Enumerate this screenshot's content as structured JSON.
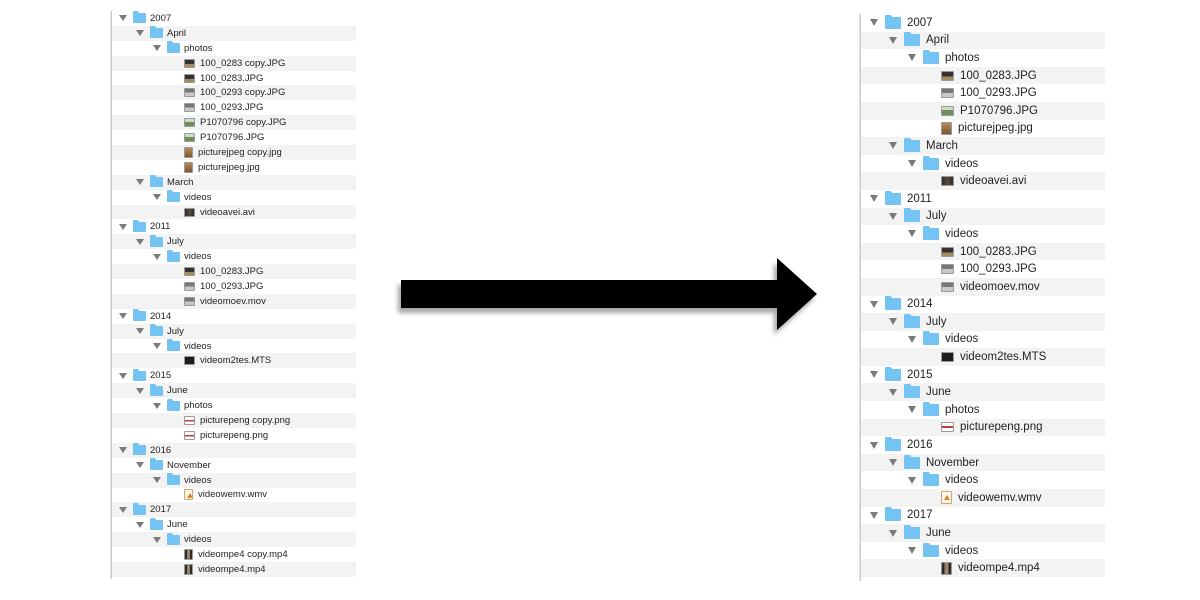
{
  "left_tree": [
    {
      "label": "2007",
      "level": 0,
      "kind": "folder"
    },
    {
      "label": "April",
      "level": 1,
      "kind": "folder"
    },
    {
      "label": "photos",
      "level": 2,
      "kind": "folder"
    },
    {
      "label": "100_0283 copy.JPG",
      "level": 3,
      "kind": "file",
      "icon": "dark"
    },
    {
      "label": "100_0283.JPG",
      "level": 3,
      "kind": "file",
      "icon": "dark"
    },
    {
      "label": "100_0293 copy.JPG",
      "level": 3,
      "kind": "file",
      "icon": "gray"
    },
    {
      "label": "100_0293.JPG",
      "level": 3,
      "kind": "file",
      "icon": "gray"
    },
    {
      "label": "P1070796 copy.JPG",
      "level": 3,
      "kind": "file",
      "icon": "green"
    },
    {
      "label": "P1070796.JPG",
      "level": 3,
      "kind": "file",
      "icon": "green"
    },
    {
      "label": "picturejpeg copy.jpg",
      "level": 3,
      "kind": "file",
      "icon": "doc"
    },
    {
      "label": "picturejpeg.jpg",
      "level": 3,
      "kind": "file",
      "icon": "doc"
    },
    {
      "label": "March",
      "level": 1,
      "kind": "folder"
    },
    {
      "label": "videos",
      "level": 2,
      "kind": "folder"
    },
    {
      "label": "videoavei.avi",
      "level": 3,
      "kind": "file",
      "icon": "video"
    },
    {
      "label": "2011",
      "level": 0,
      "kind": "folder"
    },
    {
      "label": "July",
      "level": 1,
      "kind": "folder"
    },
    {
      "label": "videos",
      "level": 2,
      "kind": "folder"
    },
    {
      "label": "100_0283.JPG",
      "level": 3,
      "kind": "file",
      "icon": "dark"
    },
    {
      "label": "100_0293.JPG",
      "level": 3,
      "kind": "file",
      "icon": "gray"
    },
    {
      "label": "videomoev.mov",
      "level": 3,
      "kind": "file",
      "icon": "gray"
    },
    {
      "label": "2014",
      "level": 0,
      "kind": "folder"
    },
    {
      "label": "July",
      "level": 1,
      "kind": "folder"
    },
    {
      "label": "videos",
      "level": 2,
      "kind": "folder"
    },
    {
      "label": "videom2tes.MTS",
      "level": 3,
      "kind": "file",
      "icon": "film"
    },
    {
      "label": "2015",
      "level": 0,
      "kind": "folder"
    },
    {
      "label": "June",
      "level": 1,
      "kind": "folder"
    },
    {
      "label": "photos",
      "level": 2,
      "kind": "folder"
    },
    {
      "label": "picturepeng copy.png",
      "level": 3,
      "kind": "file",
      "icon": "png"
    },
    {
      "label": "picturepeng.png",
      "level": 3,
      "kind": "file",
      "icon": "png"
    },
    {
      "label": "2016",
      "level": 0,
      "kind": "folder"
    },
    {
      "label": "November",
      "level": 1,
      "kind": "folder"
    },
    {
      "label": "videos",
      "level": 2,
      "kind": "folder"
    },
    {
      "label": "videowemv.wmv",
      "level": 3,
      "kind": "file",
      "icon": "wmv"
    },
    {
      "label": "2017",
      "level": 0,
      "kind": "folder"
    },
    {
      "label": "June",
      "level": 1,
      "kind": "folder"
    },
    {
      "label": "videos",
      "level": 2,
      "kind": "folder"
    },
    {
      "label": "videompe4 copy.mp4",
      "level": 3,
      "kind": "file",
      "icon": "mp4"
    },
    {
      "label": "videompe4.mp4",
      "level": 3,
      "kind": "file",
      "icon": "mp4"
    }
  ],
  "right_tree": [
    {
      "label": "2007",
      "level": 0,
      "kind": "folder"
    },
    {
      "label": "April",
      "level": 1,
      "kind": "folder"
    },
    {
      "label": "photos",
      "level": 2,
      "kind": "folder"
    },
    {
      "label": "100_0283.JPG",
      "level": 3,
      "kind": "file",
      "icon": "dark"
    },
    {
      "label": "100_0293.JPG",
      "level": 3,
      "kind": "file",
      "icon": "gray"
    },
    {
      "label": "P1070796.JPG",
      "level": 3,
      "kind": "file",
      "icon": "green"
    },
    {
      "label": "picturejpeg.jpg",
      "level": 3,
      "kind": "file",
      "icon": "doc"
    },
    {
      "label": "March",
      "level": 1,
      "kind": "folder"
    },
    {
      "label": "videos",
      "level": 2,
      "kind": "folder"
    },
    {
      "label": "videoavei.avi",
      "level": 3,
      "kind": "file",
      "icon": "video"
    },
    {
      "label": "2011",
      "level": 0,
      "kind": "folder"
    },
    {
      "label": "July",
      "level": 1,
      "kind": "folder"
    },
    {
      "label": "videos",
      "level": 2,
      "kind": "folder"
    },
    {
      "label": "100_0283.JPG",
      "level": 3,
      "kind": "file",
      "icon": "dark"
    },
    {
      "label": "100_0293.JPG",
      "level": 3,
      "kind": "file",
      "icon": "gray"
    },
    {
      "label": "videomoev.mov",
      "level": 3,
      "kind": "file",
      "icon": "gray"
    },
    {
      "label": "2014",
      "level": 0,
      "kind": "folder"
    },
    {
      "label": "July",
      "level": 1,
      "kind": "folder"
    },
    {
      "label": "videos",
      "level": 2,
      "kind": "folder"
    },
    {
      "label": "videom2tes.MTS",
      "level": 3,
      "kind": "file",
      "icon": "film"
    },
    {
      "label": "2015",
      "level": 0,
      "kind": "folder"
    },
    {
      "label": "June",
      "level": 1,
      "kind": "folder"
    },
    {
      "label": "photos",
      "level": 2,
      "kind": "folder"
    },
    {
      "label": "picturepeng.png",
      "level": 3,
      "kind": "file",
      "icon": "png"
    },
    {
      "label": "2016",
      "level": 0,
      "kind": "folder"
    },
    {
      "label": "November",
      "level": 1,
      "kind": "folder"
    },
    {
      "label": "videos",
      "level": 2,
      "kind": "folder"
    },
    {
      "label": "videowemv.wmv",
      "level": 3,
      "kind": "file",
      "icon": "wmv"
    },
    {
      "label": "2017",
      "level": 0,
      "kind": "folder"
    },
    {
      "label": "June",
      "level": 1,
      "kind": "folder"
    },
    {
      "label": "videos",
      "level": 2,
      "kind": "folder"
    },
    {
      "label": "videompe4.mp4",
      "level": 3,
      "kind": "file",
      "icon": "mp4"
    }
  ],
  "colors": {
    "folder": "#74c4f3",
    "arrow": "#000000",
    "row_alt": "#f3f3f3"
  },
  "icons": {
    "folder": "folder-icon",
    "disclosure": "disclosure-triangle-icon",
    "arrow": "right-arrow-icon"
  }
}
